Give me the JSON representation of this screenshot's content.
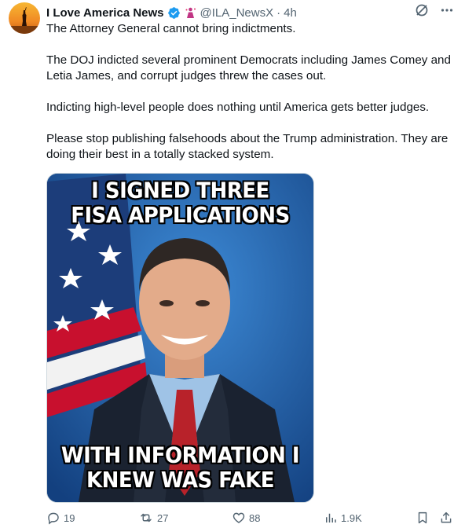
{
  "post": {
    "author_name": "I Love America News",
    "handle": "@ILA_NewsX",
    "separator": "·",
    "time": "4h",
    "paragraphs": [
      "The Attorney General cannot bring indictments.",
      "The DOJ indicted several prominent Democrats including James Comey and Letia James, and corrupt judges threw the cases out.",
      "Indicting high-level people does nothing until America gets better judges.",
      "Please stop publishing falsehoods about the Trump administration. They are doing their best in a totally stacked system."
    ],
    "media": {
      "top_text": "I SIGNED THREE\nFISA APPLICATIONS",
      "bottom_text": "WITH INFORMATION I\nKNEW WAS FAKE"
    },
    "actions": {
      "replies": "19",
      "reposts": "27",
      "likes": "88",
      "views": "1.9K"
    }
  },
  "icons": {
    "verified": "verified-badge-icon",
    "affiliation": "affiliation-icon",
    "grok": "grok-icon",
    "more": "more-icon",
    "reply": "reply-icon",
    "repost": "repost-icon",
    "like": "like-icon",
    "views": "views-icon",
    "bookmark": "bookmark-icon",
    "share": "share-icon"
  },
  "colors": {
    "text": "#0f1419",
    "secondary": "#536471",
    "verified": "#1d9bf0",
    "affiliation": "#c13584"
  }
}
